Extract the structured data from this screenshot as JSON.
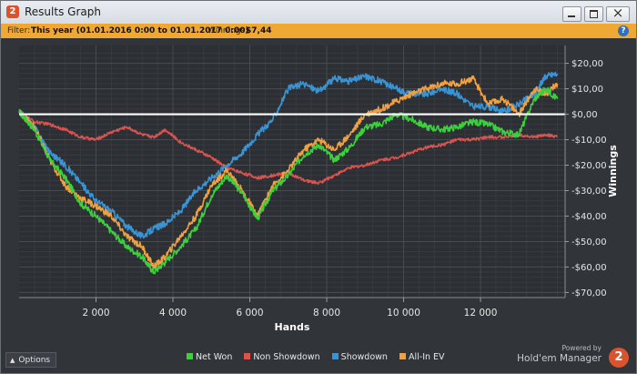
{
  "window": {
    "title": "Results Graph",
    "app_icon_text": "2"
  },
  "filter": {
    "label": "Filter:",
    "value": "This year (01.01.2016 0:00 to 01.01.2017 0:00)",
    "winnings_label": "Winnings:",
    "winnings_value": "$7,44"
  },
  "colors": {
    "net_won": "#3ecf3e",
    "non_showdown": "#d9534f",
    "showdown": "#3a94d4",
    "all_in_ev": "#f0a040",
    "filter_bar": "#f0a834",
    "background": "#2c2f34"
  },
  "icons": {
    "help": "help-icon",
    "minimize": "minimize-icon",
    "maximize": "maximize-icon",
    "close": "close-icon"
  },
  "options": {
    "label": "Options"
  },
  "brand": {
    "powered_by": "Powered by",
    "name": "Hold'em Manager",
    "logo_text": "2"
  },
  "chart_data": {
    "type": "line",
    "title": "",
    "xlabel": "Hands",
    "ylabel": "Winnings",
    "xlim": [
      0,
      14200
    ],
    "ylim": [
      -72,
      27
    ],
    "grid": true,
    "legend_position": "bottom",
    "x_ticks": [
      2000,
      4000,
      6000,
      8000,
      10000,
      12000
    ],
    "x_tick_labels": [
      "2 000",
      "4 000",
      "6 000",
      "8 000",
      "10 000",
      "12 000"
    ],
    "y_ticks": [
      20,
      10,
      0,
      -10,
      -20,
      -30,
      -40,
      -50,
      -60,
      -70
    ],
    "y_tick_labels": [
      "$20,00",
      "$10,00",
      "$0,00",
      "-$10,00",
      "-$20,00",
      "-$30,00",
      "-$40,00",
      "-$50,00",
      "-$60,00",
      "-$70,00"
    ],
    "x": [
      0,
      400,
      800,
      1200,
      1600,
      2000,
      2400,
      2800,
      3200,
      3500,
      3800,
      4200,
      4600,
      5000,
      5400,
      5800,
      6200,
      6600,
      7000,
      7400,
      7800,
      8200,
      8600,
      9000,
      9400,
      9800,
      10200,
      10600,
      11000,
      11400,
      11800,
      12200,
      12600,
      13000,
      13400,
      13700,
      14000
    ],
    "series": [
      {
        "name": "Net Won",
        "values": [
          1,
          -6,
          -18,
          -25,
          -35,
          -40,
          -46,
          -52,
          -56,
          -62,
          -58,
          -52,
          -45,
          -32,
          -24,
          -31,
          -41,
          -30,
          -24,
          -16,
          -12,
          -18,
          -13,
          -5,
          -4,
          0,
          -2,
          -5,
          -6,
          -5,
          -3,
          -4,
          -7,
          -8,
          6,
          10,
          6
        ]
      },
      {
        "name": "Non Showdown",
        "values": [
          1,
          -3,
          -4,
          -6,
          -9,
          -10,
          -7,
          -5,
          -8,
          -9,
          -6,
          -11,
          -14,
          -17,
          -21,
          -23,
          -25,
          -24,
          -23,
          -26,
          -27,
          -24,
          -21,
          -20,
          -18,
          -17,
          -15,
          -13,
          -12,
          -10,
          -10,
          -9,
          -9,
          -8,
          -9,
          -8,
          -9
        ]
      },
      {
        "name": "Showdown",
        "values": [
          1,
          -5,
          -15,
          -20,
          -27,
          -34,
          -38,
          -44,
          -48,
          -45,
          -43,
          -38,
          -30,
          -25,
          -20,
          -15,
          -8,
          -2,
          10,
          12,
          9,
          14,
          13,
          15,
          13,
          10,
          8,
          8,
          10,
          8,
          3,
          3,
          1,
          4,
          8,
          15,
          16
        ]
      },
      {
        "name": "All-In EV",
        "values": [
          1,
          -5,
          -18,
          -28,
          -33,
          -36,
          -40,
          -48,
          -52,
          -60,
          -56,
          -48,
          -40,
          -28,
          -22,
          -30,
          -40,
          -28,
          -22,
          -14,
          -10,
          -14,
          -8,
          0,
          2,
          5,
          8,
          10,
          12,
          12,
          14,
          4,
          6,
          0,
          10,
          8,
          12
        ]
      }
    ]
  },
  "legend": {
    "items": [
      "Net Won",
      "Non Showdown",
      "Showdown",
      "All-In EV"
    ]
  }
}
